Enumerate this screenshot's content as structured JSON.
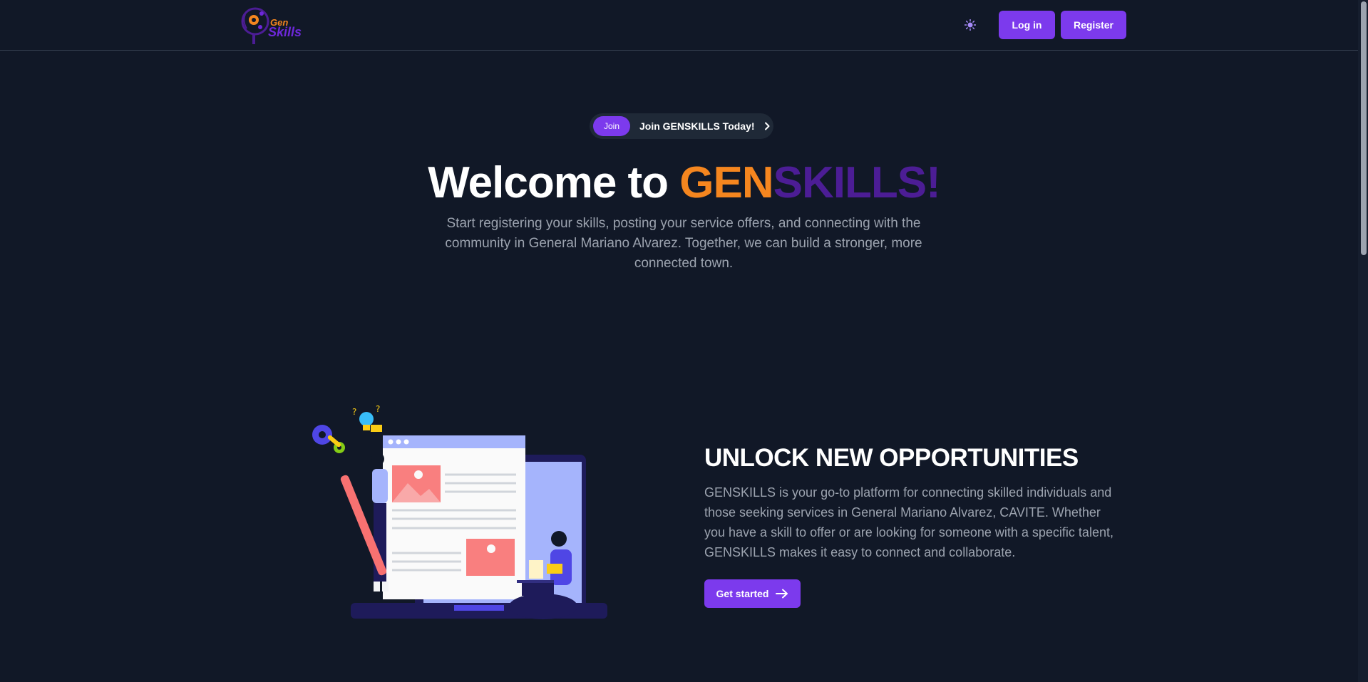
{
  "header": {
    "logo": {
      "line1": "Gen",
      "line2": "Skills"
    },
    "login_label": "Log in",
    "register_label": "Register",
    "theme_icon": "sun-icon"
  },
  "hero": {
    "join_badge": "Join",
    "join_text": "Join GENSKILLS Today!",
    "title_prefix": "Welcome to ",
    "title_gen": "GEN",
    "title_skills": "SKILLS!",
    "subtitle": "Start registering your skills, posting your service offers, and connecting with the community in General Mariano Alvarez. Together, we can build a stronger, more connected town."
  },
  "opportunities": {
    "title": "UNLOCK NEW OPPORTUNITIES",
    "description": "GENSKILLS is your go-to platform for connecting skilled individuals and those seeking services in General Mariano Alvarez, CAVITE. Whether you have a skill to offer or are looking for someone with a specific talent, GENSKILLS makes it easy to connect and collaborate.",
    "cta_label": "Get started"
  },
  "colors": {
    "background": "#111827",
    "accent": "#7c3aed",
    "orange": "#f5861f",
    "deep_purple": "#4c1d95"
  }
}
